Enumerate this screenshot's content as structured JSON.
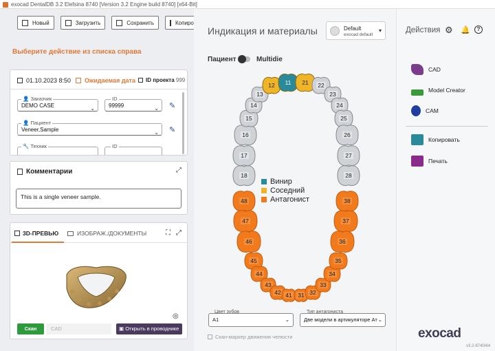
{
  "window": {
    "title": "exocad DentalDB 3.2 Elefsina 8740 [Version 3.2 Engine build 8740] [x64-Bit]"
  },
  "toolbar": {
    "new": "Новый",
    "load": "Загрузить",
    "save": "Сохранить",
    "copy": "Копирова"
  },
  "hint": "Выберите действие из списка справа",
  "order": {
    "date": "01.10.2023 8:50",
    "expected": "Ожидаемая дата",
    "project_label": "ID проекта",
    "project_id": "999",
    "customer_label": "Заказчик",
    "customer_value": "DEMO CASE",
    "id_label": "ID",
    "id_value": "99999",
    "patient_label": "Пациент",
    "patient_value": "Veneer,Sample",
    "tech_label": "Техник",
    "id2_label": "ID"
  },
  "comments": {
    "title": "Комментарии",
    "text": "This is a single veneer sample."
  },
  "preview": {
    "tab_3d": "3D-ПРЕВЬЮ",
    "tab_images": "ИЗОБРАЖ./ДОКУМЕНТЫ",
    "scan_label": "Скан",
    "cad_label": "CAD",
    "explorer_label": "Открыть в проводнике"
  },
  "center": {
    "title": "Индикация и материалы",
    "material_default": "Default",
    "material_sub": "exocad default",
    "patient_label": "Пациент",
    "multidie_label": "Multidie",
    "legend": [
      {
        "label": "Винир",
        "color": "#2a8a9a"
      },
      {
        "label": "Соседний",
        "color": "#f0b429"
      },
      {
        "label": "Антагонист",
        "color": "#f07a1c"
      }
    ],
    "tooth_color_label": "Цвет зубов",
    "tooth_color_value": "A1",
    "antagonist_type_label": "Тип антагониста",
    "antagonist_type_value": "Две модели в артикуляторе Ат",
    "jaw_motion_label": "Скан-маркер движения челюсти",
    "upper_teeth": [
      "18",
      "17",
      "16",
      "15",
      "14",
      "13",
      "12",
      "11",
      "21",
      "22",
      "23",
      "24",
      "25",
      "26",
      "27",
      "28"
    ],
    "lower_teeth": [
      "48",
      "47",
      "46",
      "45",
      "44",
      "43",
      "42",
      "41",
      "31",
      "32",
      "33",
      "34",
      "35",
      "36",
      "37",
      "38"
    ]
  },
  "right": {
    "title": "Действия",
    "items": [
      "CAD",
      "Model Creator",
      "CAM",
      "Копировать",
      "Печать"
    ]
  },
  "brand": {
    "logo": "exocad",
    "version": "v3.2-8740/64"
  }
}
